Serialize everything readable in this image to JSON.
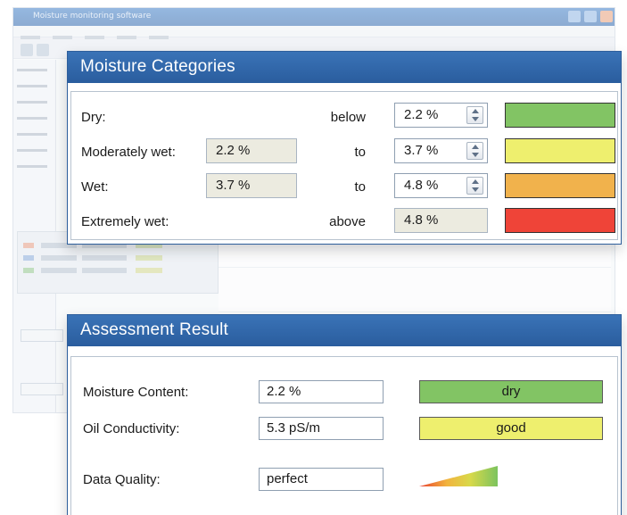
{
  "background_window": {
    "title": "Moisture monitoring software"
  },
  "moisture_panel": {
    "title": "Moisture Categories",
    "rows": [
      {
        "label": "Dry:",
        "lower": "",
        "word": "below",
        "upper": "2.2 %",
        "upper_editable": true,
        "color": "#82c464"
      },
      {
        "label": "Moderately wet:",
        "lower": "2.2 %",
        "word": "to",
        "upper": "3.7 %",
        "upper_editable": true,
        "color": "#eeef6e"
      },
      {
        "label": "Wet:",
        "lower": "3.7 %",
        "word": "to",
        "upper": "4.8 %",
        "upper_editable": true,
        "color": "#f1b24c"
      },
      {
        "label": "Extremely wet:",
        "lower": "",
        "word": "above",
        "upper": "4.8 %",
        "upper_editable": false,
        "color": "#ef4438"
      }
    ]
  },
  "assessment_panel": {
    "title": "Assessment Result",
    "rows": [
      {
        "label": "Moisture Content:",
        "value": "2.2 %",
        "status": "dry",
        "status_color": "#82c464"
      },
      {
        "label": "Oil Conductivity:",
        "value": "5.3 pS/m",
        "status": "good",
        "status_color": "#eeef6e"
      },
      {
        "label": "Data Quality:",
        "value": "perfect",
        "indicator": "quality-gradient-icon"
      }
    ]
  }
}
